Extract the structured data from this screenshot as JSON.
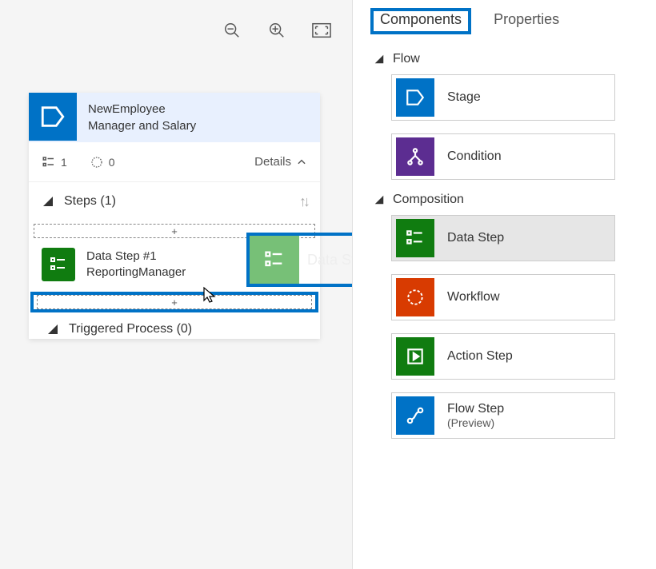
{
  "tabs": {
    "components": "Components",
    "properties": "Properties"
  },
  "sections": {
    "flow": "Flow",
    "composition": "Composition"
  },
  "components": {
    "stage": "Stage",
    "condition": "Condition",
    "datastep": "Data Step",
    "workflow": "Workflow",
    "actionstep": "Action Step",
    "flowstep_l1": "Flow Step",
    "flowstep_l2": "(Preview)"
  },
  "stage": {
    "title1": "NewEmployee",
    "title2": "Manager and Salary",
    "count1": "1",
    "count0": "0",
    "details": "Details",
    "steps_label": "Steps (1)",
    "drop_plus": "+",
    "ds_name": "Data Step #1",
    "ds_sub": "ReportingManager",
    "triggered": "Triggered Process (0)"
  },
  "drag": {
    "label": "Data Step"
  }
}
